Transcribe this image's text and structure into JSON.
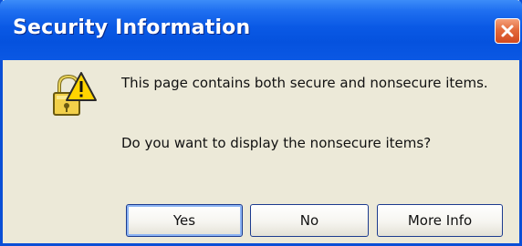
{
  "window": {
    "title": "Security Information",
    "close_icon": "close-icon"
  },
  "dialog": {
    "icon": "warning-lock-icon",
    "message": "This page contains both secure and nonsecure items.",
    "question": "Do you want to display the nonsecure items?"
  },
  "buttons": {
    "yes_label": "Yes",
    "no_label": "No",
    "more_info_label": "More Info"
  },
  "colors": {
    "titlebar": "#0a59e5",
    "close_button": "#e36b3c",
    "dialog_background": "#ece9d8",
    "button_border": "#1c3b8f"
  }
}
